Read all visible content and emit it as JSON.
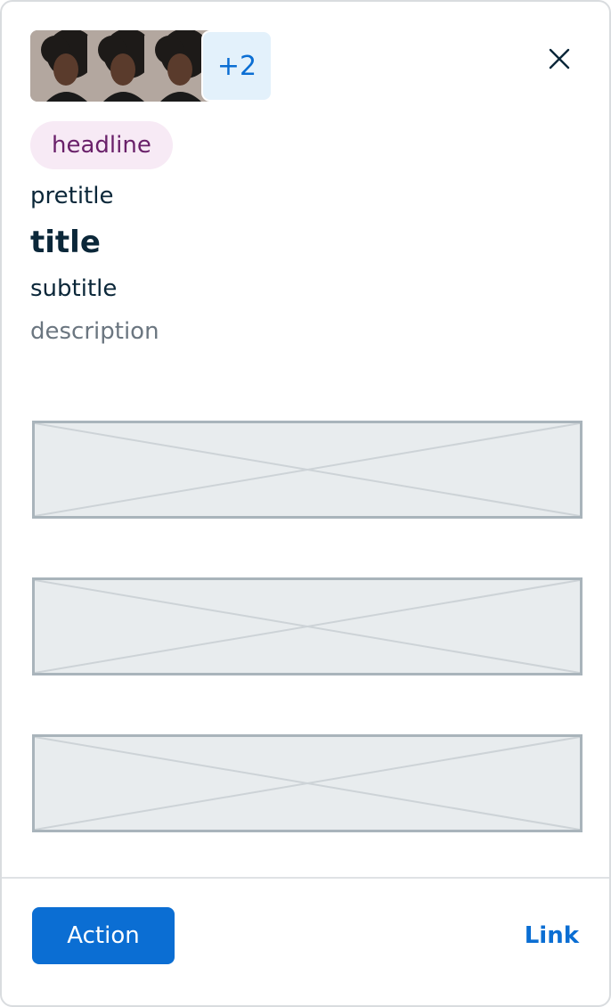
{
  "avatars": {
    "icon": "person-photo",
    "overflow_count": "+2"
  },
  "close": {
    "icon": "close-icon"
  },
  "headline": "headline",
  "pretitle": "pretitle",
  "title": "title",
  "subtitle": "subtitle",
  "description": "description",
  "slots": {
    "icon": "image-placeholder-icon"
  },
  "footer": {
    "action_label": "Action",
    "link_label": "Link"
  },
  "colors": {
    "primary": "#0b6ed3",
    "text": "#0b2739",
    "muted_text": "#6b7680",
    "headline_bg": "#f7eaf5",
    "headline_text": "#6a216a",
    "more_bg": "#e3f1fb"
  }
}
